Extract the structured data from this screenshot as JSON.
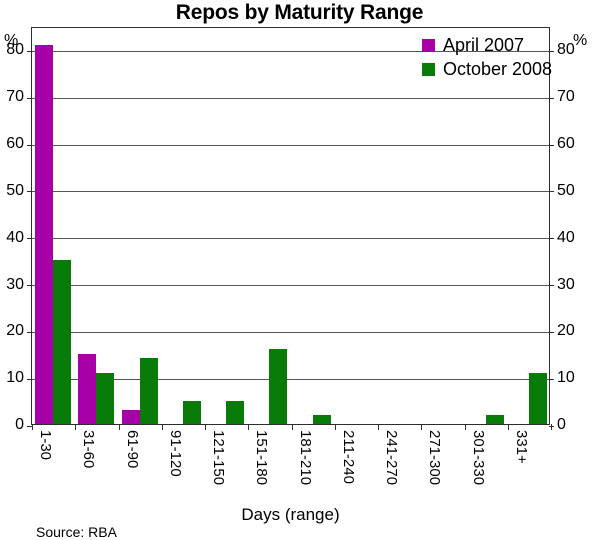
{
  "chart_data": {
    "type": "bar",
    "title": "Repos by Maturity Range",
    "xlabel": "Days (range)",
    "ylabel": "%",
    "ylabel_right": "%",
    "ylim": [
      0,
      85
    ],
    "yticks": [
      0,
      10,
      20,
      30,
      40,
      50,
      60,
      70,
      80
    ],
    "grid": true,
    "legend_position": "top-right",
    "source": "Source:  RBA",
    "categories": [
      "1-30",
      "31-60",
      "61-90",
      "91-120",
      "121-150",
      "151-180",
      "181-210",
      "211-240",
      "241-270",
      "271-300",
      "301-330",
      "331+"
    ],
    "series": [
      {
        "name": "April 2007",
        "color": "#a800a8",
        "values": [
          81,
          15,
          3,
          0,
          0,
          0,
          0,
          0,
          0,
          0,
          0,
          0
        ]
      },
      {
        "name": "October 2008",
        "color": "#087a08",
        "values": [
          35,
          11,
          14,
          5,
          5,
          16,
          2,
          0,
          0,
          0,
          2,
          11
        ]
      }
    ]
  }
}
